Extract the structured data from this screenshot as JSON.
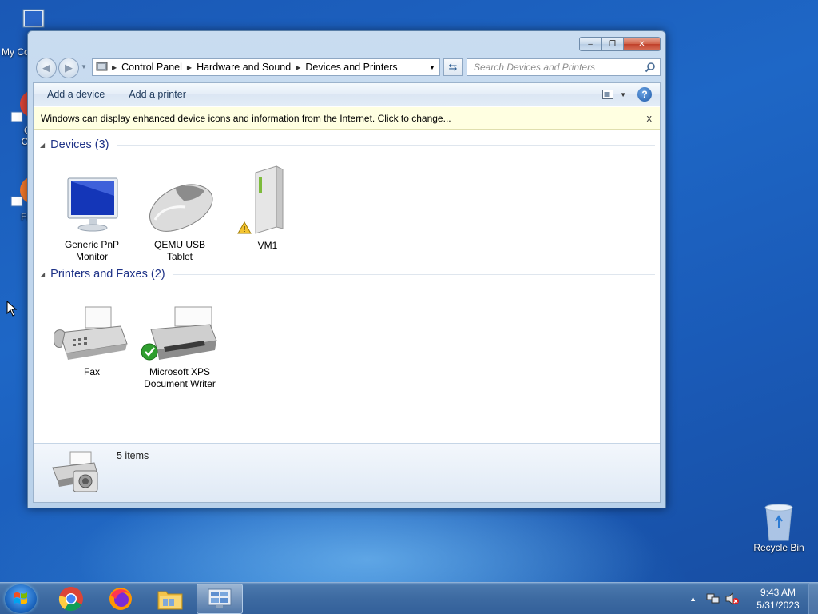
{
  "desktop": {
    "icons": [
      {
        "label": "My Co"
      },
      {
        "label": "Go\nChr"
      },
      {
        "label": "Fir"
      },
      {
        "label": "Recycle Bin"
      }
    ]
  },
  "window": {
    "controls": {
      "minimize": "minimize-icon",
      "maximize": "restore-icon",
      "close": "close-icon"
    },
    "address": {
      "crumbs": [
        "Control Panel",
        "Hardware and Sound",
        "Devices and Printers"
      ]
    },
    "search": {
      "placeholder": "Search Devices and Printers"
    },
    "toolbar": {
      "add_device": "Add a device",
      "add_printer": "Add a printer"
    },
    "infobar": {
      "text": "Windows can display enhanced device icons and information from the Internet. Click to change...",
      "close": "x"
    },
    "groups": {
      "devices": {
        "title": "Devices (3)",
        "items": [
          {
            "line1": "Generic PnP",
            "line2": "Monitor",
            "icon": "monitor-icon"
          },
          {
            "line1": "QEMU USB",
            "line2": "Tablet",
            "icon": "mouse-icon"
          },
          {
            "line1": "VM1",
            "line2": "",
            "icon": "computer-tower-icon",
            "status": "warning"
          }
        ]
      },
      "printers": {
        "title": "Printers and Faxes (2)",
        "items": [
          {
            "line1": "Fax",
            "line2": "",
            "icon": "fax-icon"
          },
          {
            "line1": "Microsoft XPS",
            "line2": "Document Writer",
            "icon": "printer-icon",
            "status": "default"
          }
        ]
      }
    },
    "details": {
      "count": "5 items"
    }
  },
  "taskbar": {
    "apps": [
      "chrome-icon",
      "firefox-icon",
      "file-explorer-icon",
      "devices-and-printers-icon"
    ],
    "clock": {
      "time": "9:43 AM",
      "date": "5/31/2023"
    }
  }
}
